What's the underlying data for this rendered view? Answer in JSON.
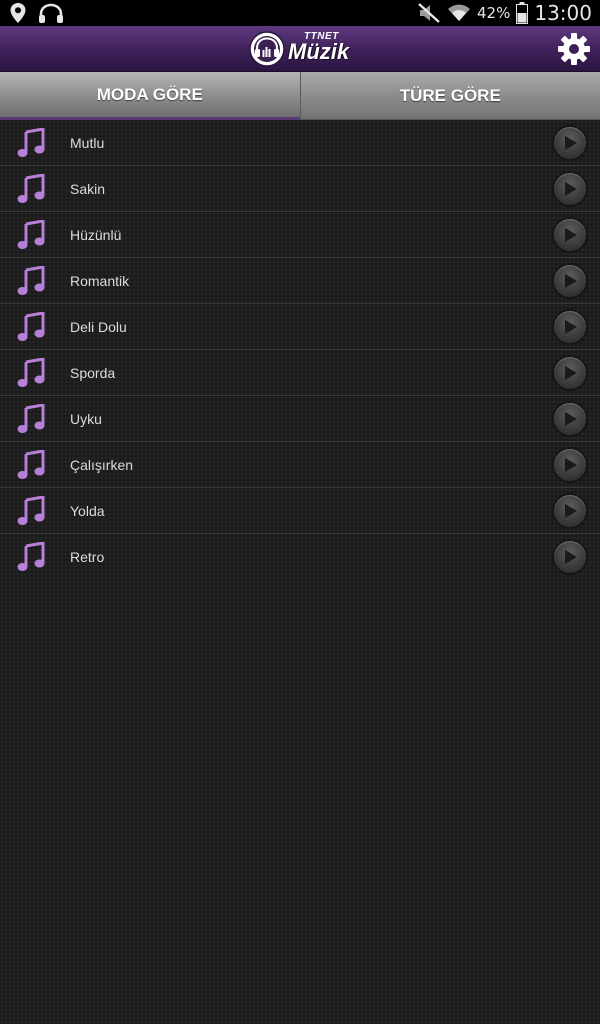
{
  "status_bar": {
    "battery_percent": "42%",
    "time": "13:00",
    "icons": [
      "location-icon",
      "headphones-icon",
      "mute-icon",
      "wifi-icon",
      "battery-icon"
    ]
  },
  "header": {
    "logo_small": "TTNET",
    "logo_main": "Müzik",
    "settings_icon": "gear-icon",
    "bar_color": "#3e2059"
  },
  "tabs": [
    {
      "label": "MODA GÖRE",
      "active": true
    },
    {
      "label": "TÜRE GÖRE",
      "active": false
    }
  ],
  "moods": {
    "item_icon": "music-note-icon",
    "action_icon": "play-icon",
    "note_color": "#b67fd8",
    "items": [
      {
        "label": "Mutlu"
      },
      {
        "label": "Sakin"
      },
      {
        "label": "Hüzünlü"
      },
      {
        "label": "Romantik"
      },
      {
        "label": "Deli Dolu"
      },
      {
        "label": "Sporda"
      },
      {
        "label": "Uyku"
      },
      {
        "label": "Çalışırken"
      },
      {
        "label": "Yolda"
      },
      {
        "label": "Retro"
      }
    ]
  }
}
